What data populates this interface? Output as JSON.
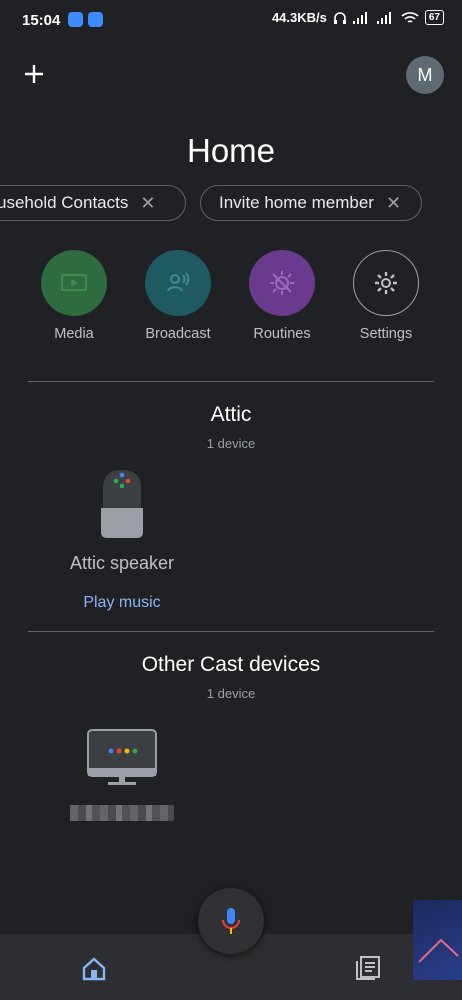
{
  "status_bar": {
    "time": "15:04",
    "network_speed": "44.3KB/s",
    "battery": "67"
  },
  "header": {
    "title": "Home",
    "avatar_letter": "M"
  },
  "chips": [
    {
      "label": "usehold Contacts"
    },
    {
      "label": "Invite home member"
    }
  ],
  "actions": [
    {
      "label": "Media",
      "color": "#2e6b3e"
    },
    {
      "label": "Broadcast",
      "color": "#1f5a63"
    },
    {
      "label": "Routines",
      "color": "#6a3a8f"
    },
    {
      "label": "Settings",
      "color": "#202124"
    }
  ],
  "rooms": [
    {
      "title": "Attic",
      "count": "1 device",
      "device": {
        "name": "Attic speaker",
        "action": "Play music"
      }
    },
    {
      "title": "Other Cast devices",
      "count": "1 device"
    }
  ],
  "icons": {
    "add": "plus-icon",
    "home_tab": "home-icon",
    "feed_tab": "feed-icon",
    "mic": "microphone-icon"
  },
  "colors": {
    "background": "#202124",
    "accent": "#8ab4f8"
  }
}
